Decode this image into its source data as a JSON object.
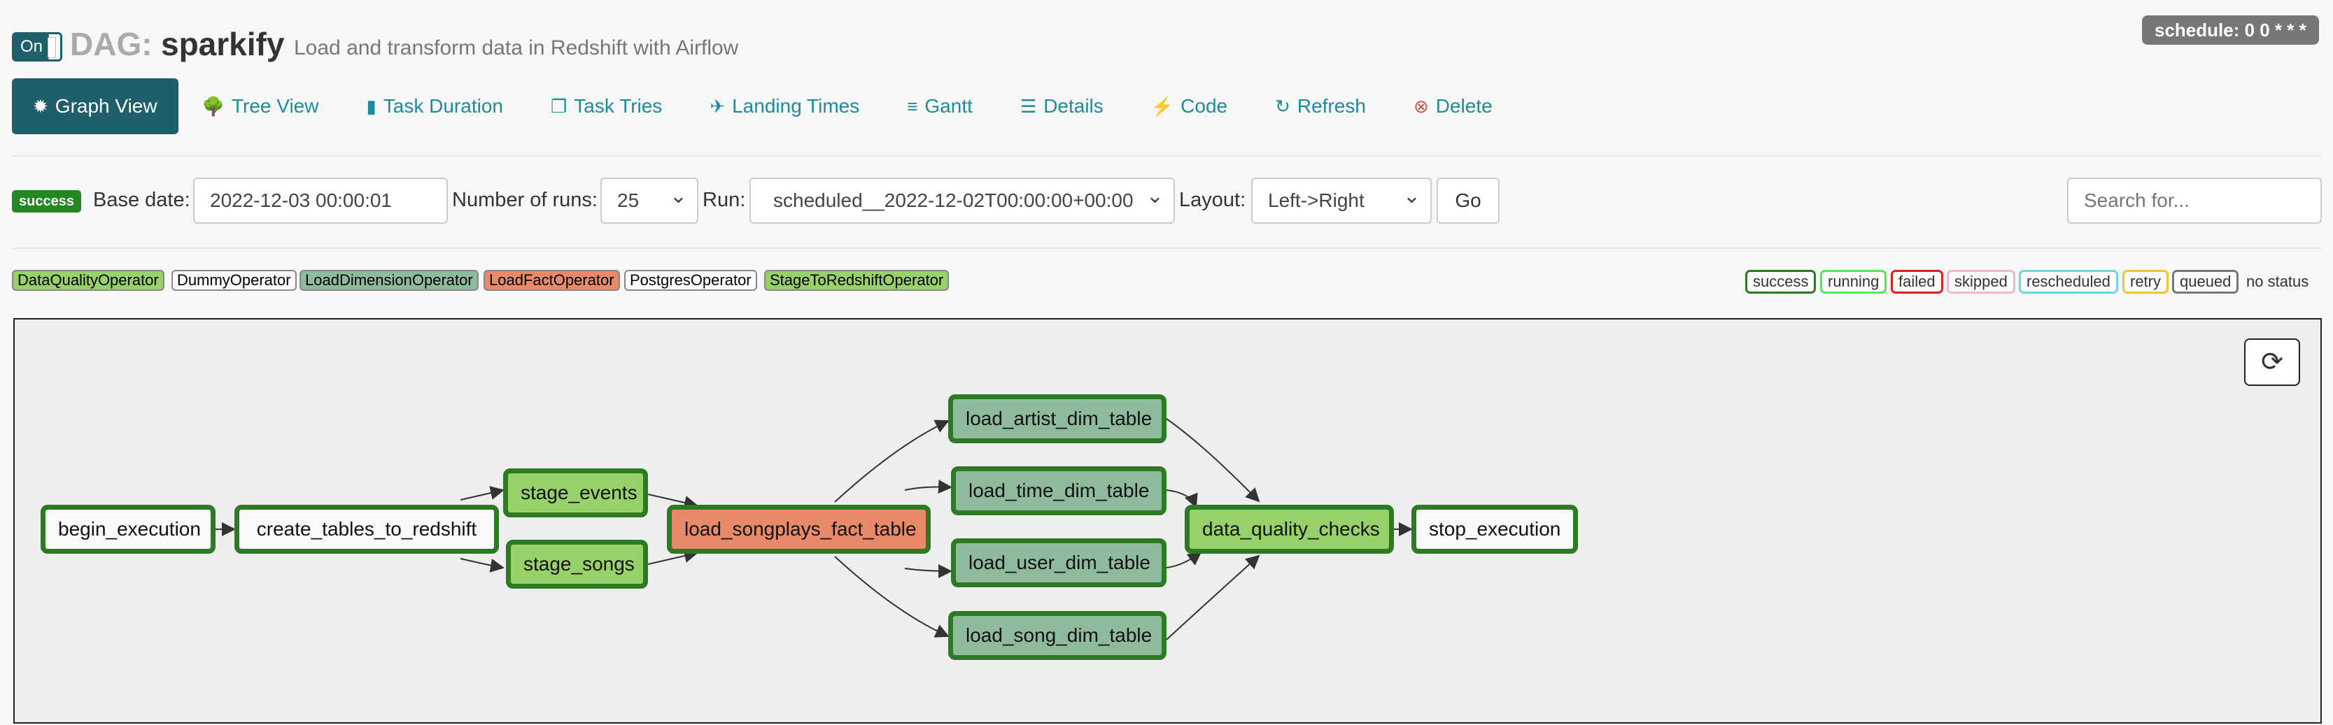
{
  "header": {
    "toggle_label": "On",
    "dag_prefix": "DAG:",
    "dag_name": "sparkify",
    "dag_description": "Load and transform data in Redshift with Airflow",
    "schedule": "schedule: 0 0 * * *"
  },
  "nav": {
    "items": [
      {
        "label": "Graph View",
        "icon": "asterisk-icon",
        "active": true
      },
      {
        "label": "Tree View",
        "icon": "tree-icon"
      },
      {
        "label": "Task Duration",
        "icon": "bar-chart-icon"
      },
      {
        "label": "Task Tries",
        "icon": "files-icon"
      },
      {
        "label": "Landing Times",
        "icon": "plane-icon"
      },
      {
        "label": "Gantt",
        "icon": "align-left-icon"
      },
      {
        "label": "Details",
        "icon": "list-icon"
      },
      {
        "label": "Code",
        "icon": "flash-icon"
      },
      {
        "label": "Refresh",
        "icon": "refresh-icon"
      },
      {
        "label": "Delete",
        "icon": "delete-circle-icon"
      }
    ]
  },
  "form": {
    "state_badge": "success",
    "base_date_label": "Base date:",
    "base_date_value": "2022-12-03 00:00:01",
    "num_runs_label": "Number of runs:",
    "num_runs_value": "25",
    "run_label": "Run:",
    "run_value": "scheduled__2022-12-02T00:00:00+00:00",
    "layout_label": "Layout:",
    "layout_value": "Left->Right",
    "go_label": "Go",
    "search_placeholder": "Search for..."
  },
  "legend": {
    "operators": [
      {
        "label": "DataQualityOperator",
        "color": "#97d169"
      },
      {
        "label": "DummyOperator",
        "color": "#fafafa"
      },
      {
        "label": "LoadDimensionOperator",
        "color": "#8dbb9b"
      },
      {
        "label": "LoadFactOperator",
        "color": "#e8896a"
      },
      {
        "label": "PostgresOperator",
        "color": "#ffffff"
      },
      {
        "label": "StageToRedshiftOperator",
        "color": "#97d169"
      }
    ],
    "states": [
      {
        "label": "success",
        "color": "#2d7a25"
      },
      {
        "label": "running",
        "color": "#55e655"
      },
      {
        "label": "failed",
        "color": "#e02020"
      },
      {
        "label": "skipped",
        "color": "#f7b6c6"
      },
      {
        "label": "rescheduled",
        "color": "#6fd8d8"
      },
      {
        "label": "retry",
        "color": "#f2c430"
      },
      {
        "label": "queued",
        "color": "#777777"
      }
    ],
    "no_status": "no status"
  },
  "graph": {
    "nodes": {
      "begin_execution": "begin_execution",
      "create_tables_to_redshift": "create_tables_to_redshift",
      "stage_events": "stage_events",
      "stage_songs": "stage_songs",
      "load_songplays_fact_table": "load_songplays_fact_table",
      "load_artist_dim_table": "load_artist_dim_table",
      "load_time_dim_table": "load_time_dim_table",
      "load_user_dim_table": "load_user_dim_table",
      "load_song_dim_table": "load_song_dim_table",
      "data_quality_checks": "data_quality_checks",
      "stop_execution": "stop_execution"
    }
  }
}
